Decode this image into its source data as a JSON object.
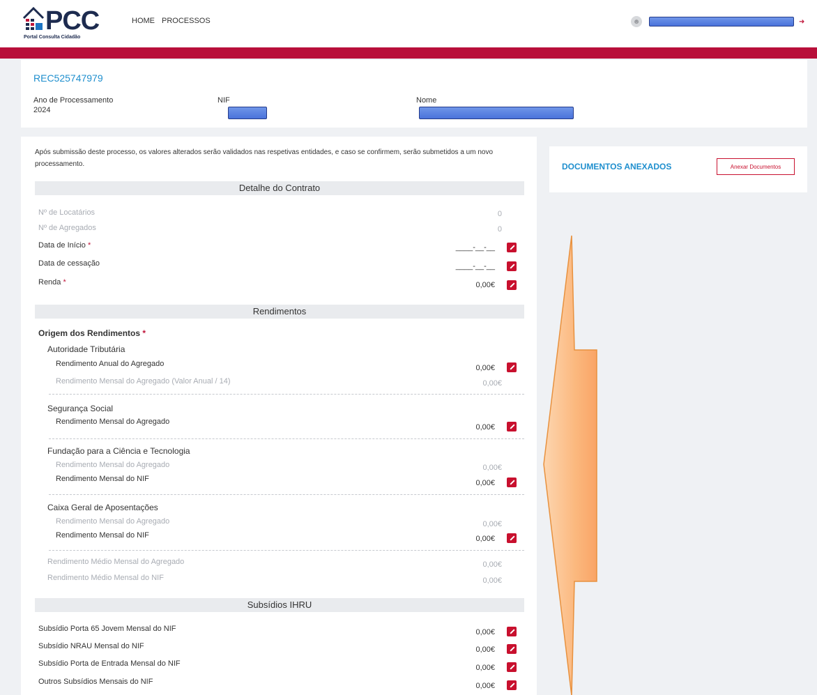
{
  "header": {
    "logo_text": "PCC",
    "logo_subtitle": "Portal Consulta Cidadão",
    "nav": [
      "HOME",
      "PROCESSOS"
    ],
    "logout_icon": "sign-out-icon",
    "avatar_icon": "user-icon"
  },
  "process": {
    "id": "REC525747979",
    "year_label": "Ano de Processamento",
    "year_value": "2024",
    "nif_label": "NIF",
    "nif_value": "",
    "name_label": "Nome",
    "name_value": ""
  },
  "intro_text": "Após submissão deste processo, os valores alterados serão validados nas respetivas entidades, e caso se confirmem, serão submetidos a um novo processamento.",
  "contract": {
    "title": "Detalhe do Contrato",
    "locatarios_label": "Nº de Locatários",
    "locatarios_value": "0",
    "agregados_label": "Nº de Agregados",
    "agregados_value": "0",
    "inicio_label": "Data de Início",
    "inicio_value": "____-__-__",
    "cessacao_label": "Data de cessação",
    "cessacao_value": "____-__-__",
    "renda_label": "Renda",
    "renda_value": "0,00€",
    "required_mark": "*"
  },
  "income": {
    "title": "Rendimentos",
    "origin_title": "Origem dos Rendimentos",
    "at": {
      "title": "Autoridade Tributária",
      "annual_label": "Rendimento Anual do Agregado",
      "annual_value": "0,00€",
      "monthly_label": "Rendimento Mensal do Agregado (Valor Anual / 14)",
      "monthly_value": "0,00€"
    },
    "ss": {
      "title": "Segurança Social",
      "monthly_label": "Rendimento Mensal do Agregado",
      "monthly_value": "0,00€"
    },
    "fct": {
      "title": "Fundação para a Ciência e Tecnologia",
      "agg_label": "Rendimento Mensal do Agregado",
      "agg_value": "0,00€",
      "nif_label": "Rendimento Mensal do NIF",
      "nif_value": "0,00€"
    },
    "cga": {
      "title": "Caixa Geral de Aposentações",
      "agg_label": "Rendimento Mensal do Agregado",
      "agg_value": "0,00€",
      "nif_label": "Rendimento Mensal do NIF",
      "nif_value": "0,00€"
    },
    "avg_agg_label": "Rendimento Médio Mensal do Agregado",
    "avg_agg_value": "0,00€",
    "avg_nif_label": "Rendimento Médio Mensal do NIF",
    "avg_nif_value": "0,00€"
  },
  "subsidies": {
    "title": "Subsídios IHRU",
    "items": [
      {
        "label": "Subsídio Porta 65 Jovem Mensal do NIF",
        "value": "0,00€"
      },
      {
        "label": "Subsídio NRAU Mensal do NIF",
        "value": "0,00€"
      },
      {
        "label": "Subsídio Porta de Entrada Mensal do NIF",
        "value": "0,00€"
      },
      {
        "label": "Outros Subsídios Mensais do NIF",
        "value": "0,00€"
      }
    ]
  },
  "documents": {
    "title": "DOCUMENTOS ANEXADOS",
    "attach_button": "Anexar Documentos"
  },
  "colors": {
    "brand_red": "#b80f3a",
    "link_blue": "#1f8fce",
    "navy": "#1d2b4f",
    "arrow_fill": "#fbb87e"
  }
}
